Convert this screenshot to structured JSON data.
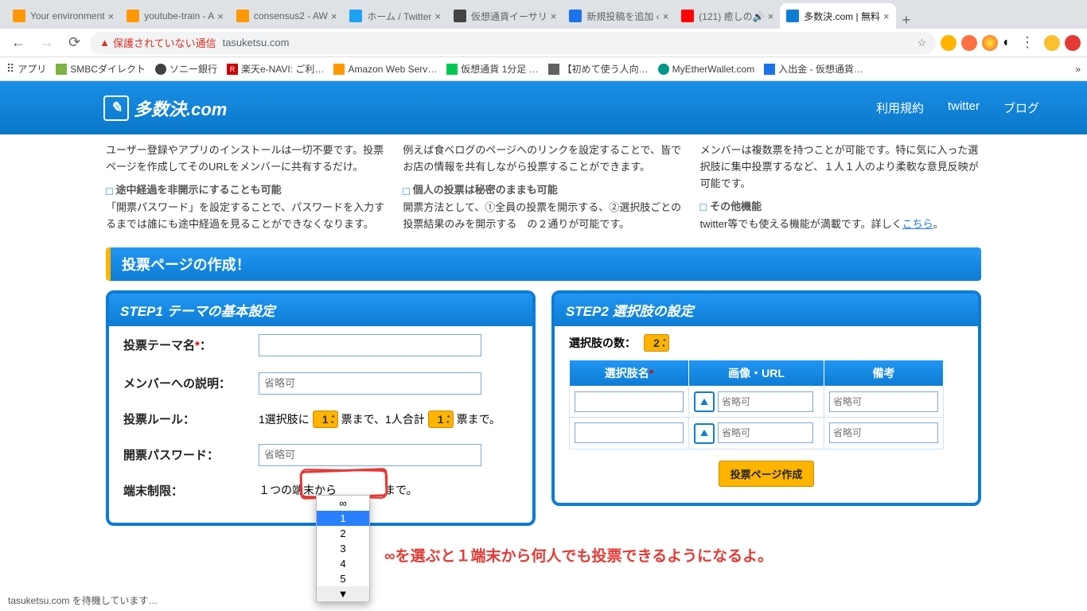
{
  "browser": {
    "tabs": [
      {
        "title": "Your environment",
        "fav": "#ff9800"
      },
      {
        "title": "youtube-train - A",
        "fav": "#ff9800"
      },
      {
        "title": "consensus2 - AW",
        "fav": "#ff9800"
      },
      {
        "title": "ホーム / Twitter",
        "fav": "#1da1f2"
      },
      {
        "title": "仮想通貨イーサリ",
        "fav": "#444"
      },
      {
        "title": "新規投稿を追加 ‹",
        "fav": "#1a73e8"
      },
      {
        "title": "(121) 癒しの🔊",
        "fav": "#ff0000"
      },
      {
        "title": "多数決.com | 無料",
        "fav": "#0d7cd4",
        "active": true
      }
    ],
    "url_warn": "保護されていない通信",
    "url_host": "tasuketsu.com",
    "bookmarks": [
      {
        "label": "アプリ",
        "c": "#5f6368"
      },
      {
        "label": "SMBCダイレクト",
        "c": "#7cb342"
      },
      {
        "label": "ソニー銀行",
        "c": "#424242"
      },
      {
        "label": "楽天e-NAVI: ご利…",
        "c": "#cc0000"
      },
      {
        "label": "Amazon Web Serv…",
        "c": "#ff9800"
      },
      {
        "label": "仮想通貨 1分足 …",
        "c": "#00c853"
      },
      {
        "label": "【初めて使う人向…",
        "c": "#616161"
      },
      {
        "label": "MyEtherWallet.com",
        "c": "#009688"
      },
      {
        "label": "入出金 - 仮想通貨…",
        "c": "#1a73e8"
      }
    ]
  },
  "site": {
    "logo_text": "多数決.com",
    "nav": {
      "a": "利用規約",
      "b": "twitter",
      "c": "ブログ"
    }
  },
  "features": {
    "a1_body": "ユーザー登録やアプリのインストールは一切不要です。投票ページを作成してそのURLをメンバーに共有するだけ。",
    "a2_head": "途中経過を非開示にすることも可能",
    "a2_body": "「開票パスワード」を設定することで、パスワードを入力するまでは誰にも途中経過を見ることができなくなります。",
    "b1_body": "例えば食べログのページへのリンクを設定することで、皆でお店の情報を共有しながら投票することができます。",
    "b2_head": "個人の投票は秘密のままも可能",
    "b2_body": "開票方法として、①全員の投票を開示する、②選択肢ごとの投票結果のみを開示する　の２通りが可能です。",
    "c1_body": "メンバーは複数票を持つことが可能です。特に気に入った選択肢に集中投票するなど、１人１人のより柔軟な意見反映が可能です。",
    "c2_head": "その他機能",
    "c2_body_a": "twitter等でも使える機能が満載です。詳しく",
    "c2_link": "こちら",
    "c2_body_b": "。"
  },
  "section_bar": "投票ページの作成！",
  "step1": {
    "title": "STEP1 テーマの基本設定",
    "label_theme": "投票テーマ名",
    "colon": "：",
    "label_desc": "メンバーへの説明：",
    "ph_opt": "省略可",
    "label_rule": "投票ルール：",
    "rule_a": "1選択肢に",
    "rule_spin1": "1",
    "rule_b": "票まで、1人合計",
    "rule_spin2": "1",
    "rule_c": "票まで。",
    "label_pw": "開票パスワード：",
    "label_term": "端末制限：",
    "term_a": "１つの端末から",
    "term_b": "まで。"
  },
  "dropdown": {
    "items": [
      "∞",
      "1",
      "2",
      "3",
      "4",
      "5",
      "▼"
    ],
    "selected": 1
  },
  "annotation": "∞を選ぶと１端末から何人でも投票できるようになるよ。",
  "step2": {
    "title": "STEP2 選択肢の設定",
    "count_label": "選択肢の数：",
    "count_val": "2",
    "th1": "選択肢名",
    "th2": "画像・URL",
    "th3": "備考",
    "ph": "省略可",
    "submit": "投票ページ作成"
  },
  "status": "tasuketsu.com を待機しています…"
}
